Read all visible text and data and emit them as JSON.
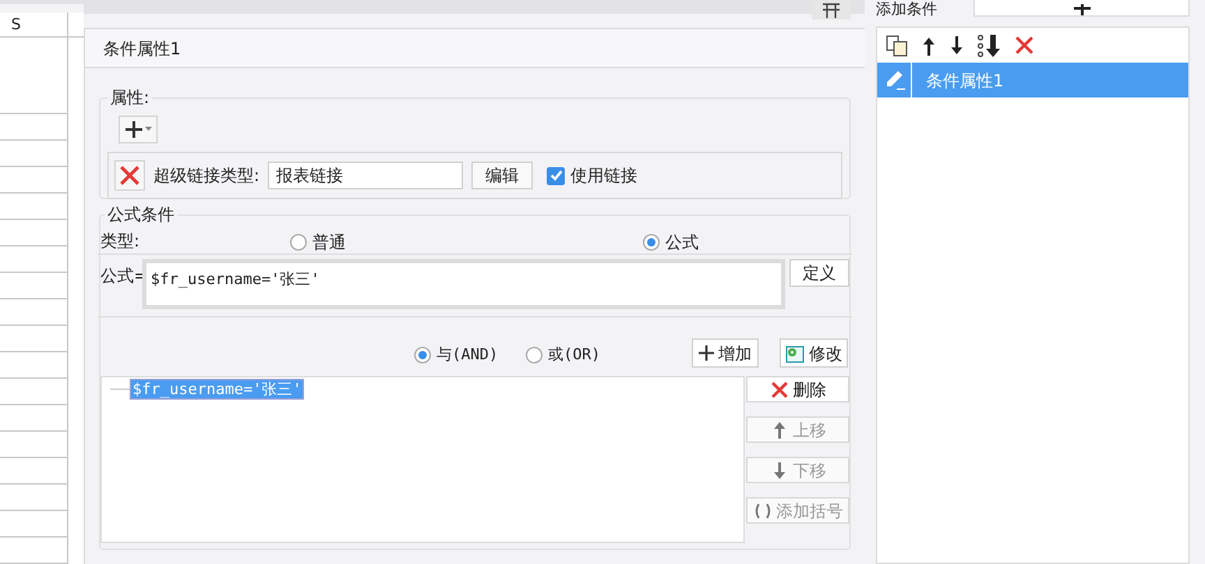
{
  "sheet": {
    "column_header": "S"
  },
  "dialog": {
    "title": "条件属性1",
    "attributes": {
      "label": "属性:",
      "hyperlink": {
        "label": "超级链接类型:",
        "value": "报表链接",
        "edit_button": "编辑",
        "use_link": {
          "label": "使用链接",
          "checked": true
        }
      }
    },
    "formula_condition": {
      "label": "公式条件",
      "type_label": "类型:",
      "types": [
        {
          "label": "普通",
          "selected": false
        },
        {
          "label": "公式",
          "selected": true
        }
      ],
      "formula_label": "公式=",
      "formula": "$fr_username='张三'",
      "define_button": "定义",
      "logic": [
        {
          "label": "与(AND)",
          "selected": true
        },
        {
          "label": "或(OR)",
          "selected": false
        }
      ],
      "add_button": "增加",
      "modify_button": "修改",
      "conditions": [
        {
          "text": "$fr_username='张三'",
          "selected": true
        }
      ],
      "actions": [
        {
          "kind": "delete",
          "label": "删除",
          "disabled": false
        },
        {
          "kind": "up",
          "label": "上移",
          "disabled": true
        },
        {
          "kind": "down",
          "label": "下移",
          "disabled": true
        },
        {
          "kind": "brackets",
          "label": "添加括号",
          "disabled": true
        }
      ]
    }
  },
  "condition_panel": {
    "title": "添加条件",
    "items": [
      {
        "label": "条件属性1",
        "selected": true
      }
    ]
  }
}
